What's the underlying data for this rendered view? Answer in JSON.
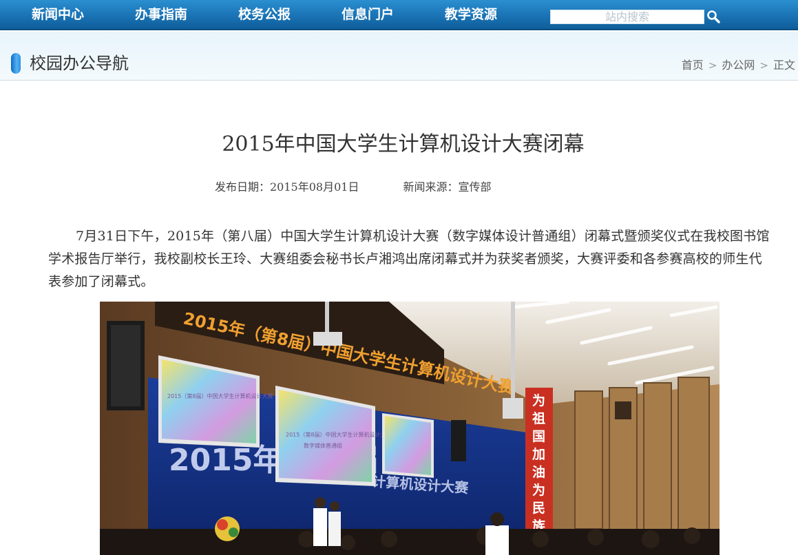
{
  "nav": {
    "items": [
      "新闻中心",
      "办事指南",
      "校务公报",
      "信息门户",
      "教学资源"
    ],
    "search_placeholder": "站内搜索"
  },
  "section": {
    "title": "校园办公导航",
    "breadcrumb": [
      "首页",
      "办公网",
      "正文"
    ]
  },
  "article": {
    "title": "2015年中国大学生计算机设计大赛闭幕",
    "date_label": "发布日期：2015年08月01日",
    "source_label": "新闻来源：宣传部",
    "body": "7月31日下午，2015年（第八届）中国大学生计算机设计大赛（数字媒体设计普通组）闭幕式暨颁奖仪式在我校图书馆学术报告厅举行，我校副校长王玲、大赛组委会秘书长卢湘鸿出席闭幕式并为获奖者颁奖，大赛评委和各参赛高校的师生代表参加了闭幕式。"
  },
  "photo": {
    "banner_text": "2015年（第8届）中国大学生计算机设计大赛",
    "backdrop_text": "2015年(第8届",
    "backdrop_text2": "计算机设计大赛",
    "pillar_text": "为祖国加油为民族争气",
    "screen_text": "2015（第8届）中国大学生计算机设计大赛",
    "screen_sub": "数字媒体普通组"
  },
  "colors": {
    "nav_blue": "#1a73b5",
    "section_bg": "#e8f4fb",
    "pill_blue": "#2d8ee0"
  },
  "icons": {
    "search": "search-icon",
    "breadcrumb_separator": "chevron-right-icon"
  }
}
